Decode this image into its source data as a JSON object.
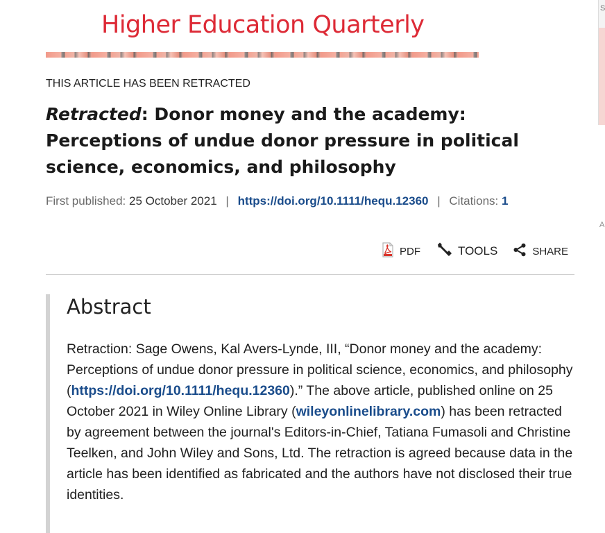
{
  "journal": {
    "title": "Higher Education Quarterly"
  },
  "article": {
    "retraction_notice": "THIS ARTICLE HAS BEEN RETRACTED",
    "title_prefix": "Retracted",
    "title_rest": ": Donor money and the academy: Perceptions of undue donor pressure in political science, economics, and philosophy",
    "first_published_label": "First published:",
    "first_published_date": "25 October 2021",
    "doi": "https://doi.org/10.1111/hequ.12360",
    "citations_label": "Citations:",
    "citations_count": "1"
  },
  "toolbar": {
    "pdf_label": "PDF",
    "tools_label": "TOOLS",
    "share_label": "SHARE"
  },
  "abstract": {
    "heading": "Abstract",
    "text_1": "Retraction: Sage Owens, Kal Avers-Lynde, III, “Donor money and the academy: Perceptions of undue donor pressure in political science, economics, and philosophy (",
    "doi_link": "https://doi.org/10.1111/hequ.12360",
    "text_2": ").” The above article, published online on 25 October 2021 in Wiley Online Library (",
    "site_link": "wileyonlinelibrary.com",
    "text_3": ") has been retracted by agreement between the journal's Editors-in-Chief, Tatiana Fumasoli and Christine Teelken, and John Wiley and Sons, Ltd. The retraction is agreed because data in the article has been identified as fabricated and the authors have not disclosed their true identities."
  },
  "side_panel": {
    "mark_top": "S",
    "mark_mid": "A"
  },
  "colors": {
    "journal_red": "#dd2a36",
    "link_blue": "#1a4c8b",
    "pdf_red": "#d9342b"
  },
  "icons": [
    "pdf-icon",
    "wrench-icon",
    "share-icon"
  ]
}
